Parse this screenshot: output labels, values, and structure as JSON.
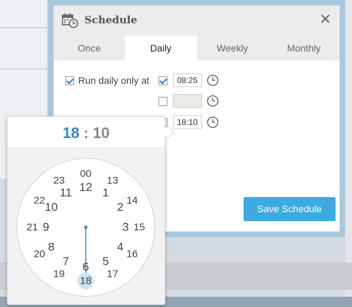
{
  "dialog": {
    "title": "Schedule",
    "close_label": "✕",
    "tabs": [
      {
        "label": "Once",
        "active": false
      },
      {
        "label": "Daily",
        "active": true
      },
      {
        "label": "Weekly",
        "active": false
      },
      {
        "label": "Monthly",
        "active": false
      }
    ],
    "run_daily_label": "Run daily only at",
    "run_daily_checked": true,
    "times": [
      {
        "checked": true,
        "value": "08:25"
      },
      {
        "checked": false,
        "value": ""
      },
      {
        "checked": false,
        "value": "18:10"
      }
    ],
    "save_button": "Save Schedule"
  },
  "clock": {
    "hour": "18",
    "separator": ":",
    "minute": "10",
    "outer_numbers": [
      "00",
      "13",
      "14",
      "15",
      "16",
      "17",
      "18",
      "19",
      "20",
      "21",
      "22",
      "23"
    ],
    "inner_numbers": [
      "12",
      "1",
      "2",
      "3",
      "4",
      "5",
      "6",
      "7",
      "8",
      "9",
      "10",
      "11"
    ],
    "selected": "18",
    "accent": "#3a84c6",
    "highlight": "#c8e3f7"
  },
  "colors": {
    "save_button": "#3da9e0",
    "dialog_border": "#a9c7dd"
  }
}
